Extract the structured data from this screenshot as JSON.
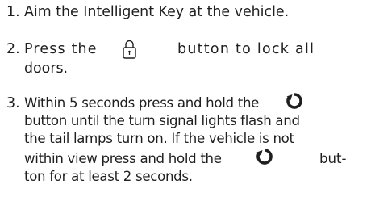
{
  "steps": [
    {
      "number": "1.",
      "lines": [
        "Aim the Intelligent Key at the vehicle."
      ]
    },
    {
      "number": "2.",
      "lines": [
        "Press the",
        "button to lock all",
        "doors."
      ],
      "icon": "lock-button-icon"
    },
    {
      "number": "3.",
      "lines": [
        "Within 5 seconds press and hold the",
        "button until the turn signal lights flash and",
        "the tail lamps turn on. If the vehicle is not",
        "within view press and hold the",
        "but-",
        "ton for at least 2 seconds."
      ],
      "icons": [
        "remote-start-icon",
        "remote-start-icon"
      ]
    }
  ],
  "colors": {
    "text": "#1f1f1f",
    "background": "#ffffff"
  }
}
